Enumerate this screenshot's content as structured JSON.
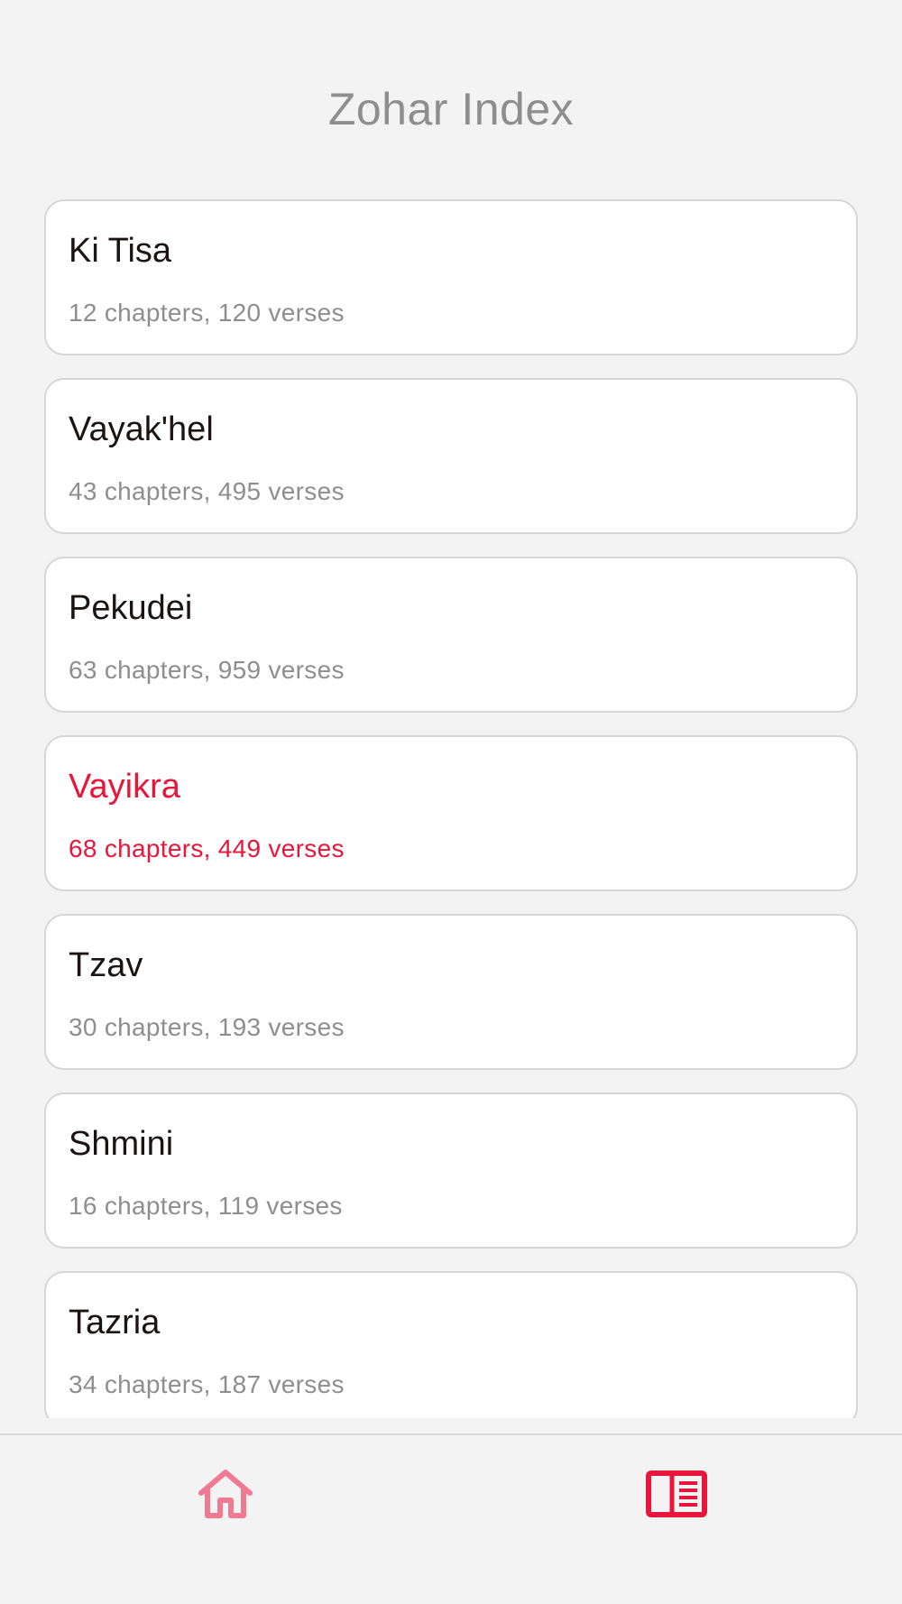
{
  "header": {
    "title": "Zohar Index"
  },
  "accent_color": "#e8163a",
  "list": {
    "items": [
      {
        "name": "Ki Tisa",
        "meta": "12 chapters, 120 verses",
        "active": false
      },
      {
        "name": "Vayak'hel",
        "meta": "43 chapters, 495 verses",
        "active": false
      },
      {
        "name": "Pekudei",
        "meta": "63 chapters, 959 verses",
        "active": false
      },
      {
        "name": "Vayikra",
        "meta": "68 chapters, 449 verses",
        "active": true
      },
      {
        "name": "Tzav",
        "meta": "30 chapters, 193 verses",
        "active": false
      },
      {
        "name": "Shmini",
        "meta": "16 chapters, 119 verses",
        "active": false
      },
      {
        "name": "Tazria",
        "meta": "34 chapters, 187 verses",
        "active": false
      }
    ]
  },
  "tabbar": {
    "tabs": [
      {
        "icon": "home-icon",
        "selected": false
      },
      {
        "icon": "book-index-icon",
        "selected": true
      }
    ]
  }
}
